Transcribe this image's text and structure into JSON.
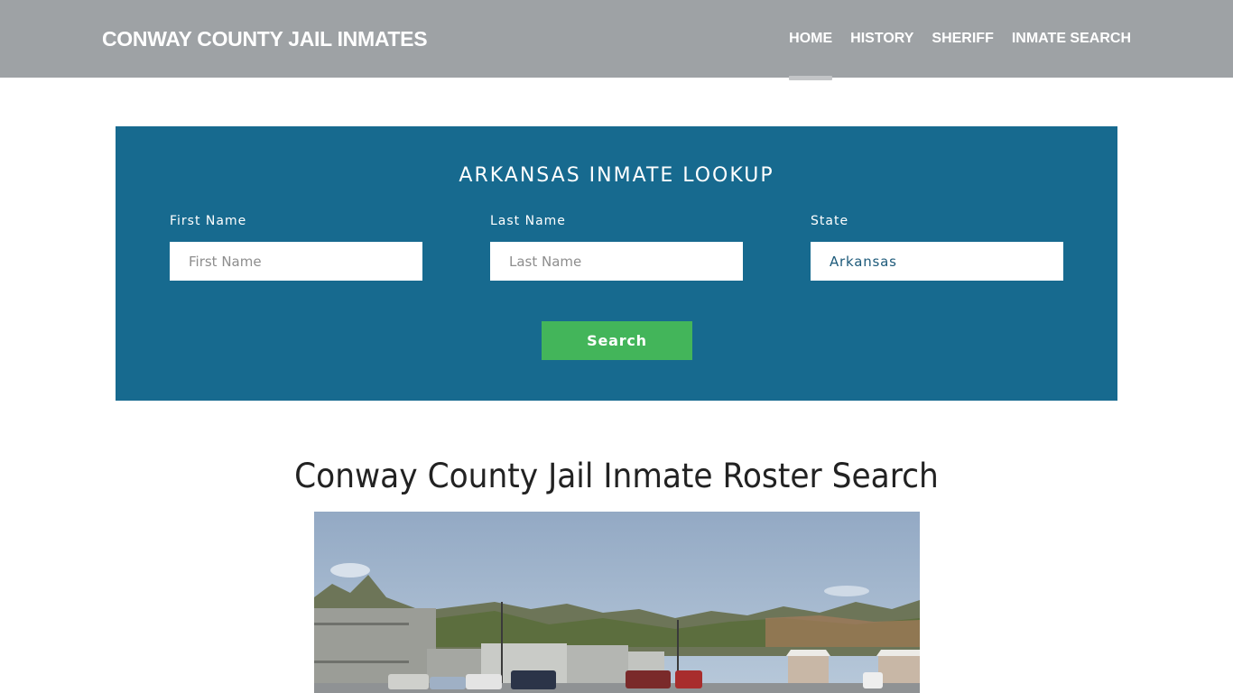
{
  "header": {
    "brand": "CONWAY COUNTY JAIL INMATES",
    "nav": [
      {
        "label": "HOME",
        "active": true
      },
      {
        "label": "HISTORY",
        "active": false
      },
      {
        "label": "SHERIFF",
        "active": false
      },
      {
        "label": "INMATE SEARCH",
        "active": false
      }
    ]
  },
  "lookup": {
    "title": "ARKANSAS INMATE LOOKUP",
    "first_name": {
      "label": "First Name",
      "placeholder": "First Name",
      "value": ""
    },
    "last_name": {
      "label": "Last Name",
      "placeholder": "Last Name",
      "value": ""
    },
    "state": {
      "label": "State",
      "value": "Arkansas"
    },
    "search_label": "Search"
  },
  "main": {
    "title": "Conway County Jail Inmate Roster Search",
    "image_alt": "Conway County Jail building"
  },
  "colors": {
    "navbar": "#9ea2a5",
    "lookup_bg": "#176a8f",
    "search_button": "#43b55a"
  }
}
